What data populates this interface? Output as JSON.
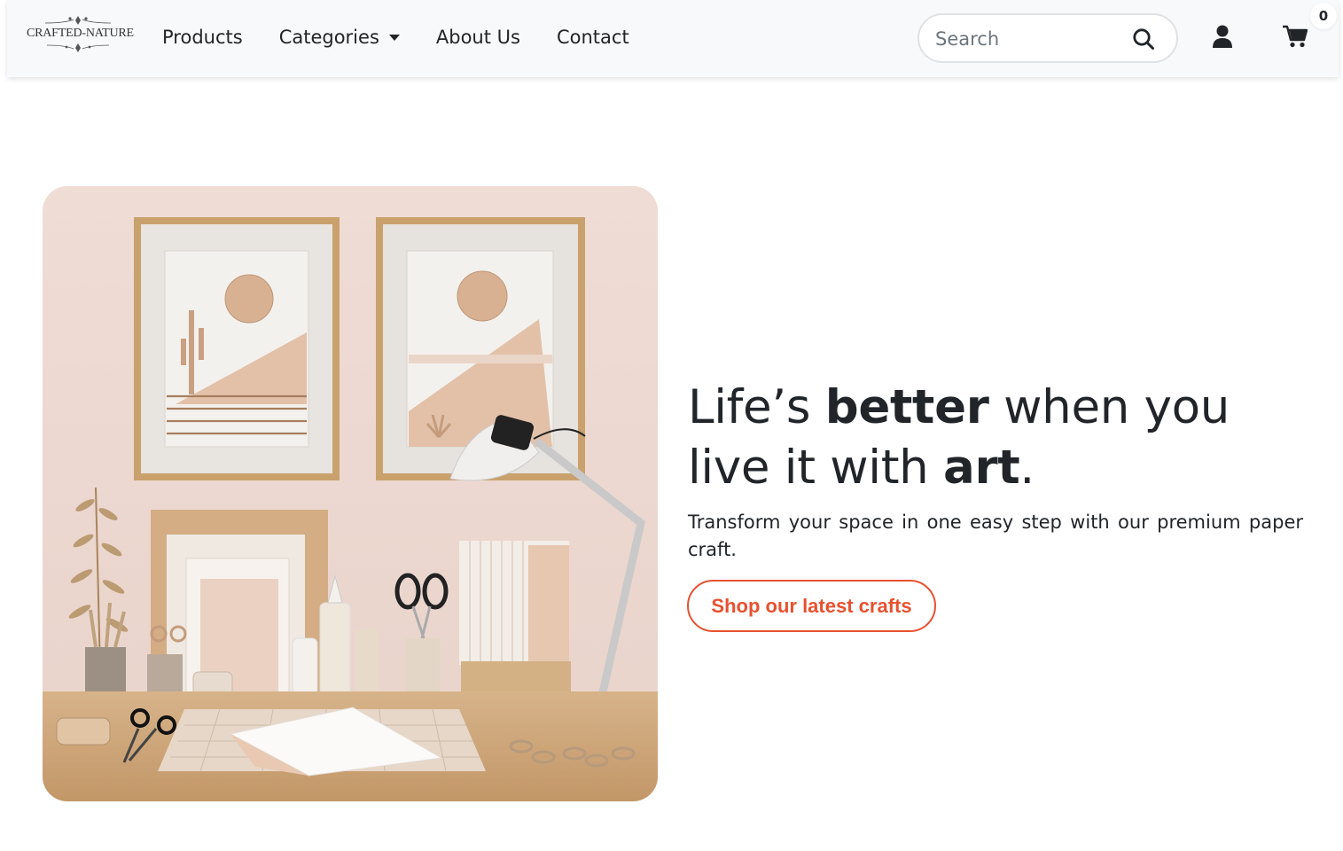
{
  "brand": {
    "name": "CRAFTED-NATURE"
  },
  "nav": {
    "links": [
      {
        "label": "Products"
      },
      {
        "label": "Categories",
        "has_dropdown": true
      },
      {
        "label": "About Us"
      },
      {
        "label": "Contact"
      }
    ]
  },
  "search": {
    "placeholder": "Search",
    "value": "",
    "icon": "search-icon"
  },
  "account": {
    "icon": "user-icon"
  },
  "cart": {
    "icon": "cart-icon",
    "count": "0"
  },
  "hero": {
    "image_alt": "Desk with framed paper-craft desert art, lamp, scissors, glue bottles and paper supplies",
    "headline": {
      "part1": "Life’s ",
      "bold1": "better",
      "part2": " when you live it with ",
      "bold2": "art",
      "part3": "."
    },
    "subtext": "Transform your space in one easy step with our premium paper craft.",
    "cta_label": "Shop our latest crafts"
  },
  "colors": {
    "accent": "#e8512f",
    "navbar_bg": "#f8f9fa",
    "text": "#212529"
  }
}
